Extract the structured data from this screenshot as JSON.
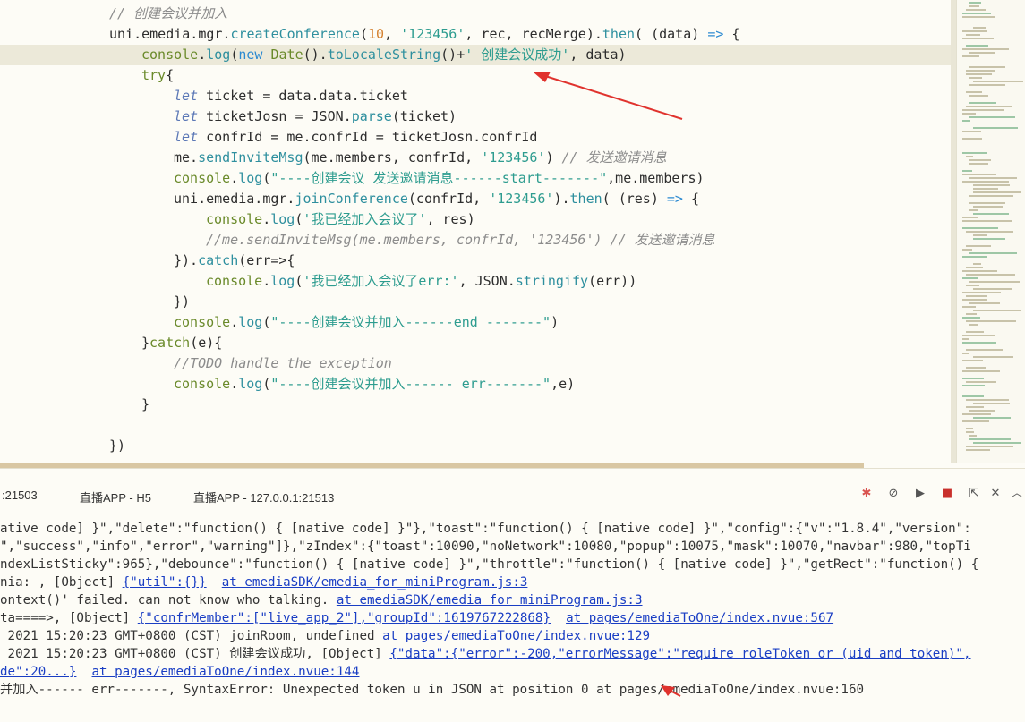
{
  "editor": {
    "lines": [
      {
        "indent": 122,
        "tokens": [
          {
            "c": "c",
            "t": "// 创建会议并加入"
          }
        ]
      },
      {
        "indent": 122,
        "tokens": [
          {
            "c": "t",
            "t": "uni.emedia.mgr."
          },
          {
            "c": "f",
            "t": "createConference"
          },
          {
            "c": "t",
            "t": "("
          },
          {
            "c": "n",
            "t": "10"
          },
          {
            "c": "t",
            "t": ", "
          },
          {
            "c": "s",
            "t": "'123456'"
          },
          {
            "c": "t",
            "t": ", rec, recMerge)."
          },
          {
            "c": "f",
            "t": "then"
          },
          {
            "c": "t",
            "t": "( (data) "
          },
          {
            "c": "k",
            "t": "=>"
          },
          {
            "c": "t",
            "t": " {"
          }
        ]
      },
      {
        "indent": 158,
        "tokens": [
          {
            "c": "v",
            "t": "console"
          },
          {
            "c": "t",
            "t": "."
          },
          {
            "c": "f",
            "t": "log"
          },
          {
            "c": "t",
            "t": "("
          },
          {
            "c": "k",
            "t": "new"
          },
          {
            "c": "t",
            "t": " "
          },
          {
            "c": "v",
            "t": "Date"
          },
          {
            "c": "t",
            "t": "()."
          },
          {
            "c": "f",
            "t": "toLocaleString"
          },
          {
            "c": "t",
            "t": "()+"
          },
          {
            "c": "s",
            "t": "' 创建会议成功'"
          },
          {
            "c": "t",
            "t": ", data)"
          }
        ]
      },
      {
        "indent": 158,
        "tokens": [
          {
            "c": "v",
            "t": "try"
          },
          {
            "c": "t",
            "t": "{"
          }
        ]
      },
      {
        "indent": 194,
        "tokens": [
          {
            "c": "kw-i",
            "t": "let"
          },
          {
            "c": "t",
            "t": " ticket = data.data.ticket"
          }
        ]
      },
      {
        "indent": 194,
        "tokens": [
          {
            "c": "kw-i",
            "t": "let"
          },
          {
            "c": "t",
            "t": " ticketJosn = JSON."
          },
          {
            "c": "f",
            "t": "parse"
          },
          {
            "c": "t",
            "t": "(ticket)"
          }
        ]
      },
      {
        "indent": 194,
        "tokens": [
          {
            "c": "kw-i",
            "t": "let"
          },
          {
            "c": "t",
            "t": " confrId = me.confrId = ticketJosn.confrId"
          }
        ]
      },
      {
        "indent": 194,
        "tokens": [
          {
            "c": "t",
            "t": "me."
          },
          {
            "c": "f",
            "t": "sendInviteMsg"
          },
          {
            "c": "t",
            "t": "(me.members, confrId, "
          },
          {
            "c": "s",
            "t": "'123456'"
          },
          {
            "c": "t",
            "t": ") "
          },
          {
            "c": "c",
            "t": "// 发送邀请消息"
          }
        ]
      },
      {
        "indent": 194,
        "tokens": [
          {
            "c": "v",
            "t": "console"
          },
          {
            "c": "t",
            "t": "."
          },
          {
            "c": "f",
            "t": "log"
          },
          {
            "c": "t",
            "t": "("
          },
          {
            "c": "s",
            "t": "\"----创建会议 发送邀请消息------start-------\""
          },
          {
            "c": "t",
            "t": ",me.members)"
          }
        ]
      },
      {
        "indent": 194,
        "tokens": [
          {
            "c": "t",
            "t": "uni.emedia.mgr."
          },
          {
            "c": "f",
            "t": "joinConference"
          },
          {
            "c": "t",
            "t": "(confrId, "
          },
          {
            "c": "s",
            "t": "'123456'"
          },
          {
            "c": "t",
            "t": ")."
          },
          {
            "c": "f",
            "t": "then"
          },
          {
            "c": "t",
            "t": "( (res) "
          },
          {
            "c": "k",
            "t": "=>"
          },
          {
            "c": "t",
            "t": " {"
          }
        ]
      },
      {
        "indent": 230,
        "tokens": [
          {
            "c": "v",
            "t": "console"
          },
          {
            "c": "t",
            "t": "."
          },
          {
            "c": "f",
            "t": "log"
          },
          {
            "c": "t",
            "t": "("
          },
          {
            "c": "s",
            "t": "'我已经加入会议了'"
          },
          {
            "c": "t",
            "t": ", res)"
          }
        ]
      },
      {
        "indent": 230,
        "tokens": [
          {
            "c": "c",
            "t": "//me.sendInviteMsg(me.members, confrId, '123456') // 发送邀请消息"
          }
        ]
      },
      {
        "indent": 194,
        "tokens": [
          {
            "c": "t",
            "t": "})."
          },
          {
            "c": "f",
            "t": "catch"
          },
          {
            "c": "t",
            "t": "(err=>{"
          }
        ]
      },
      {
        "indent": 230,
        "tokens": [
          {
            "c": "v",
            "t": "console"
          },
          {
            "c": "t",
            "t": "."
          },
          {
            "c": "f",
            "t": "log"
          },
          {
            "c": "t",
            "t": "("
          },
          {
            "c": "s",
            "t": "'我已经加入会议了err:'"
          },
          {
            "c": "t",
            "t": ", JSON."
          },
          {
            "c": "f",
            "t": "stringify"
          },
          {
            "c": "t",
            "t": "(err))"
          }
        ]
      },
      {
        "indent": 194,
        "tokens": [
          {
            "c": "t",
            "t": "})"
          }
        ]
      },
      {
        "indent": 194,
        "tokens": [
          {
            "c": "v",
            "t": "console"
          },
          {
            "c": "t",
            "t": "."
          },
          {
            "c": "f",
            "t": "log"
          },
          {
            "c": "t",
            "t": "("
          },
          {
            "c": "s",
            "t": "\"----创建会议并加入------end -------\""
          },
          {
            "c": "t",
            "t": ")"
          }
        ]
      },
      {
        "indent": 158,
        "tokens": [
          {
            "c": "t",
            "t": "}"
          },
          {
            "c": "v",
            "t": "catch"
          },
          {
            "c": "t",
            "t": "(e){"
          }
        ]
      },
      {
        "indent": 194,
        "tokens": [
          {
            "c": "c",
            "t": "//TODO handle the exception"
          }
        ]
      },
      {
        "indent": 194,
        "tokens": [
          {
            "c": "v",
            "t": "console"
          },
          {
            "c": "t",
            "t": "."
          },
          {
            "c": "f",
            "t": "log"
          },
          {
            "c": "t",
            "t": "("
          },
          {
            "c": "s",
            "t": "\"----创建会议并加入------ err-------\""
          },
          {
            "c": "t",
            "t": ",e)"
          }
        ]
      },
      {
        "indent": 158,
        "tokens": [
          {
            "c": "t",
            "t": "}"
          }
        ]
      },
      {
        "indent": 0,
        "tokens": []
      },
      {
        "indent": 122,
        "tokens": [
          {
            "c": "t",
            "t": "})"
          }
        ]
      }
    ]
  },
  "panel": {
    "tabs": [
      {
        "label": ":21503",
        "active": false
      },
      {
        "label": "直播APP - H5",
        "active": false
      },
      {
        "label": "直播APP - 127.0.0.1:21513",
        "active": true
      }
    ],
    "icons": [
      "bug-icon",
      "stop-log-icon",
      "play-icon",
      "record-stop-icon",
      "export-icon",
      "close-icon",
      "collapse-up-icon"
    ]
  },
  "console": {
    "lines": [
      [
        {
          "t": "ative code] }\",\"delete\":\"function() { [native code] }\"},\"toast\":\"function() { [native code] }\",\"config\":{\"v\":\"1.8.4\",\"version\":"
        }
      ],
      [
        {
          "t": "\",\"success\",\"info\",\"error\",\"warning\"]},\"zIndex\":{\"toast\":10090,\"noNetwork\":10080,\"popup\":10075,\"mask\":10070,\"navbar\":980,\"topTi"
        }
      ],
      [
        {
          "t": "ndexListSticky\":965},\"debounce\":\"function() { [native code] }\",\"throttle\":\"function() { [native code] }\",\"getRect\":\"function() {"
        }
      ],
      [
        {
          "t": "nia: , [Object] "
        },
        {
          "l": 1,
          "t": "{\"util\":{}}"
        },
        {
          "t": "  "
        },
        {
          "l": 1,
          "t": "at emediaSDK/emedia_for_miniProgram.js:3"
        }
      ],
      [
        {
          "t": "ontext()' failed. can not know who talking. "
        },
        {
          "l": 1,
          "t": "at emediaSDK/emedia_for_miniProgram.js:3"
        }
      ],
      [
        {
          "t": "ta====>, [Object] "
        },
        {
          "l": 1,
          "t": "{\"confrMember\":[\"live_app_2\"],\"groupId\":1619767222868}"
        },
        {
          "t": "  "
        },
        {
          "l": 1,
          "t": "at pages/emediaToOne/index.nvue:567"
        }
      ],
      [
        {
          "t": " 2021 15:20:23 GMT+0800 (CST) joinRoom, undefined "
        },
        {
          "l": 1,
          "t": "at pages/emediaToOne/index.nvue:129"
        }
      ],
      [
        {
          "t": " 2021 15:20:23 GMT+0800 (CST) 创建会议成功, [Object] "
        },
        {
          "l": 1,
          "t": "{\"data\":{\"error\":-200,\"errorMessage\":\"require roleToken or (uid and token)\","
        }
      ],
      [
        {
          "l": 1,
          "t": "de\":20...}"
        },
        {
          "t": "  "
        },
        {
          "l": 1,
          "t": "at pages/emediaToOne/index.nvue:144"
        }
      ],
      [
        {
          "t": "并加入------ err-------, SyntaxError: Unexpected token u in JSON at position 0 at pages/emediaToOne/index.nvue:160"
        }
      ]
    ]
  },
  "colors": {
    "annotation_arrow": "#e0322d",
    "active_tab_underline": "#3e9b3f"
  }
}
